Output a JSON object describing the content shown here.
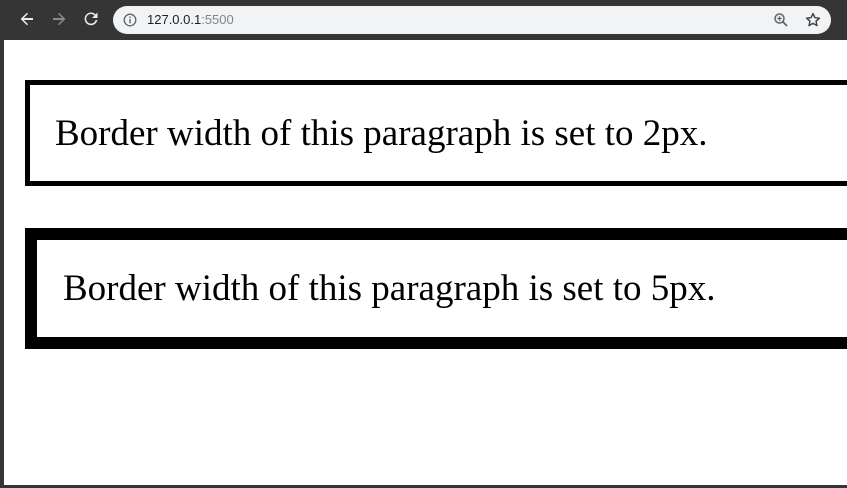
{
  "browser": {
    "url_host": "127.0.0.1",
    "url_port": ":5500",
    "icons": {
      "back": "back-arrow-icon",
      "forward": "forward-arrow-icon",
      "reload": "reload-icon",
      "info": "info-icon",
      "zoom": "zoom-icon",
      "bookmark": "star-icon"
    }
  },
  "page": {
    "paragraphs": [
      {
        "text": "Border width of this paragraph is set to 2px."
      },
      {
        "text": "Border width of this paragraph is set to 5px."
      }
    ]
  },
  "colors": {
    "chrome": "#353535",
    "omnibox": "#f1f3f4",
    "page_background": "#ffffff",
    "border": "#000000"
  }
}
